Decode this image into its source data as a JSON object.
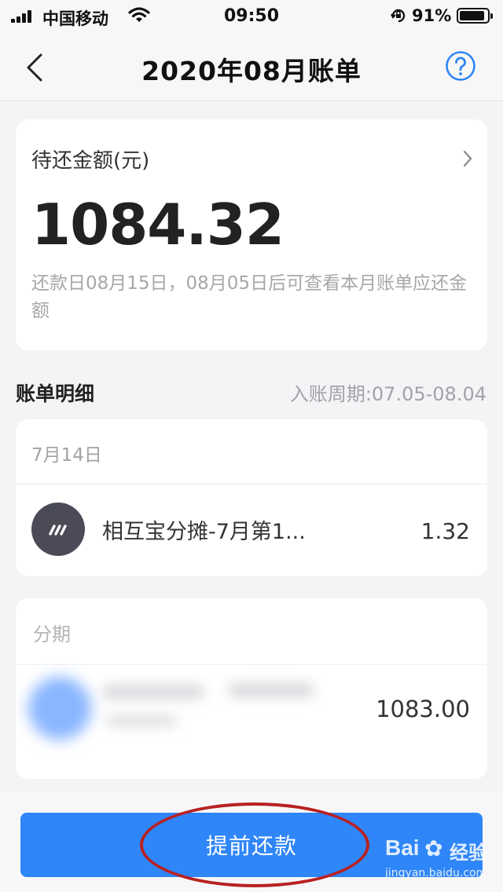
{
  "status_bar": {
    "carrier": "中国移动",
    "time": "09:50",
    "battery": "91%",
    "battery_level": 0.91,
    "icons": [
      "signal-icon",
      "wifi-icon",
      "rotation-lock-icon",
      "battery-icon"
    ]
  },
  "nav": {
    "title": "2020年08月账单",
    "back_icon": "chevron-left-icon",
    "help_icon": "question-circle-icon"
  },
  "summary": {
    "label": "待还金额(元)",
    "amount": "1084.32",
    "note": "还款日08月15日，08月05日后可查看本月账单应还金额"
  },
  "detail_section": {
    "title": "账单明细",
    "cycle": "入账周期:07.05-08.04"
  },
  "transactions": {
    "date": "7月14日",
    "items": [
      {
        "title": "相互宝分摊-7月第1...",
        "amount": "1.32"
      }
    ]
  },
  "installments": {
    "label": "分期",
    "amount": "1083.00"
  },
  "footer": {
    "prepay_label": "提前还款"
  },
  "watermark": {
    "brand": "Bai",
    "brand_cn": "经验",
    "url": "jingyan.baidu.com"
  },
  "colors": {
    "accent": "#2f86f8",
    "annotation": "#b82121",
    "background": "#f4f4f6"
  }
}
